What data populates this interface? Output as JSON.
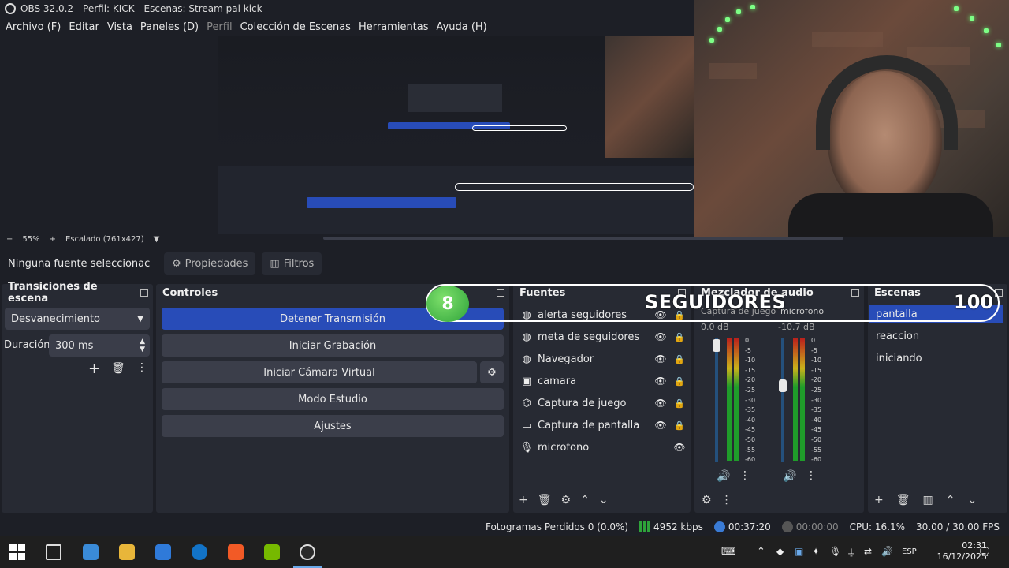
{
  "window": {
    "title": "OBS 32.0.2 - Perfil: KICK - Escenas: Stream pal kick"
  },
  "menu": [
    "Archivo (F)",
    "Editar",
    "Vista",
    "Paneles (D)",
    "Perfil",
    "Colección de Escenas",
    "Herramientas",
    "Ayuda (H)"
  ],
  "zoom": {
    "percent": "55%",
    "scale_label": "Escalado (761x427)"
  },
  "source_toolbar": {
    "selected": "Ninguna fuente seleccionac",
    "properties": "Propiedades",
    "filters": "Filtros"
  },
  "transitions": {
    "title": "Transiciones de escena",
    "selected": "Desvanecimiento",
    "duration_label": "Duración",
    "duration_value": "300 ms"
  },
  "controls": {
    "title": "Controles",
    "buttons": [
      "Detener Transmisión",
      "Iniciar Grabación",
      "Iniciar Cámara Virtual",
      "Modo Estudio",
      "Ajustes"
    ]
  },
  "sources": {
    "title": "Fuentes",
    "items": [
      {
        "name": "alerta seguidores",
        "icon": "browser-icon"
      },
      {
        "name": "meta de seguidores",
        "icon": "browser-icon"
      },
      {
        "name": "Navegador",
        "icon": "browser-icon"
      },
      {
        "name": "camara",
        "icon": "camera-icon"
      },
      {
        "name": "Captura de juego",
        "icon": "gamepad-icon"
      },
      {
        "name": "Captura de pantalla",
        "icon": "monitor-icon"
      },
      {
        "name": "microfono",
        "icon": "mic-icon"
      }
    ]
  },
  "mixer": {
    "title": "Mezclador de audio",
    "channels": [
      {
        "name": "Captura de juego",
        "db": "0.0 dB",
        "level": 1.0
      },
      {
        "name": "microfono",
        "db": "-10.7 dB",
        "level": 0.6
      }
    ],
    "scale": [
      "0",
      "-5",
      "-10",
      "-15",
      "-20",
      "-25",
      "-30",
      "-35",
      "-40",
      "-45",
      "-50",
      "-55",
      "-60"
    ]
  },
  "scenes": {
    "title": "Escenas",
    "items": [
      "pantalla",
      "reaccion",
      "iniciando"
    ],
    "selected": 0
  },
  "overlay": {
    "count": "8",
    "label": "SEGUIDORES",
    "goal": "100"
  },
  "status": {
    "dropped": "Fotogramas Perdidos 0 (0.0%)",
    "bitrate": "4952 kbps",
    "stream_time": "00:37:20",
    "rec_time": "00:00:00",
    "cpu": "CPU: 16.1%",
    "fps": "30.00 / 30.00 FPS"
  },
  "taskbar": {
    "lang": "ESP",
    "time": "02:31",
    "date": "16/12/2025"
  }
}
